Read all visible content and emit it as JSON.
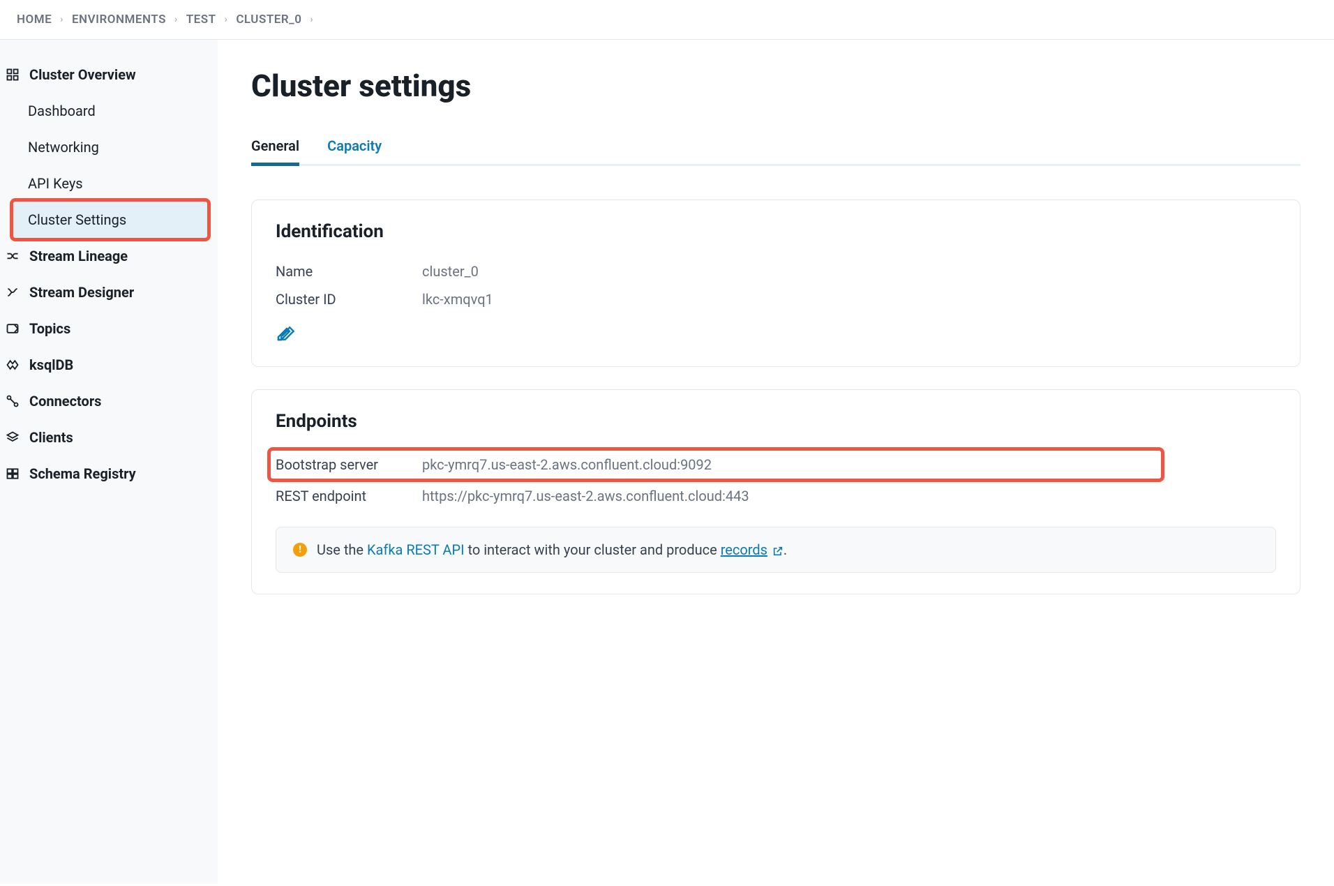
{
  "breadcrumb": [
    {
      "label": "HOME"
    },
    {
      "label": "ENVIRONMENTS"
    },
    {
      "label": "TEST"
    },
    {
      "label": "CLUSTER_0"
    }
  ],
  "sidebar": {
    "overview": {
      "label": "Cluster Overview",
      "children": [
        {
          "id": "dashboard",
          "label": "Dashboard",
          "active": false
        },
        {
          "id": "networking",
          "label": "Networking",
          "active": false
        },
        {
          "id": "api-keys",
          "label": "API Keys",
          "active": false
        },
        {
          "id": "cluster-settings",
          "label": "Cluster Settings",
          "active": true
        }
      ]
    },
    "items": [
      {
        "id": "stream-lineage",
        "label": "Stream Lineage"
      },
      {
        "id": "stream-designer",
        "label": "Stream Designer"
      },
      {
        "id": "topics",
        "label": "Topics"
      },
      {
        "id": "ksqldb",
        "label": "ksqlDB"
      },
      {
        "id": "connectors",
        "label": "Connectors"
      },
      {
        "id": "clients",
        "label": "Clients"
      },
      {
        "id": "schema-registry",
        "label": "Schema Registry"
      }
    ]
  },
  "page": {
    "title": "Cluster settings",
    "tabs": [
      {
        "id": "general",
        "label": "General",
        "active": true
      },
      {
        "id": "capacity",
        "label": "Capacity",
        "active": false
      }
    ]
  },
  "identification": {
    "heading": "Identification",
    "name_label": "Name",
    "name_value": "cluster_0",
    "cluster_id_label": "Cluster ID",
    "cluster_id_value": "lkc-xmqvq1"
  },
  "endpoints": {
    "heading": "Endpoints",
    "bootstrap_label": "Bootstrap server",
    "bootstrap_value": "pkc-ymrq7.us-east-2.aws.confluent.cloud:9092",
    "rest_label": "REST endpoint",
    "rest_value": "https://pkc-ymrq7.us-east-2.aws.confluent.cloud:443",
    "banner_prefix": "Use the ",
    "banner_link1": "Kafka REST API",
    "banner_middle": " to interact with your cluster and produce ",
    "banner_link2": "records",
    "banner_suffix": "."
  }
}
